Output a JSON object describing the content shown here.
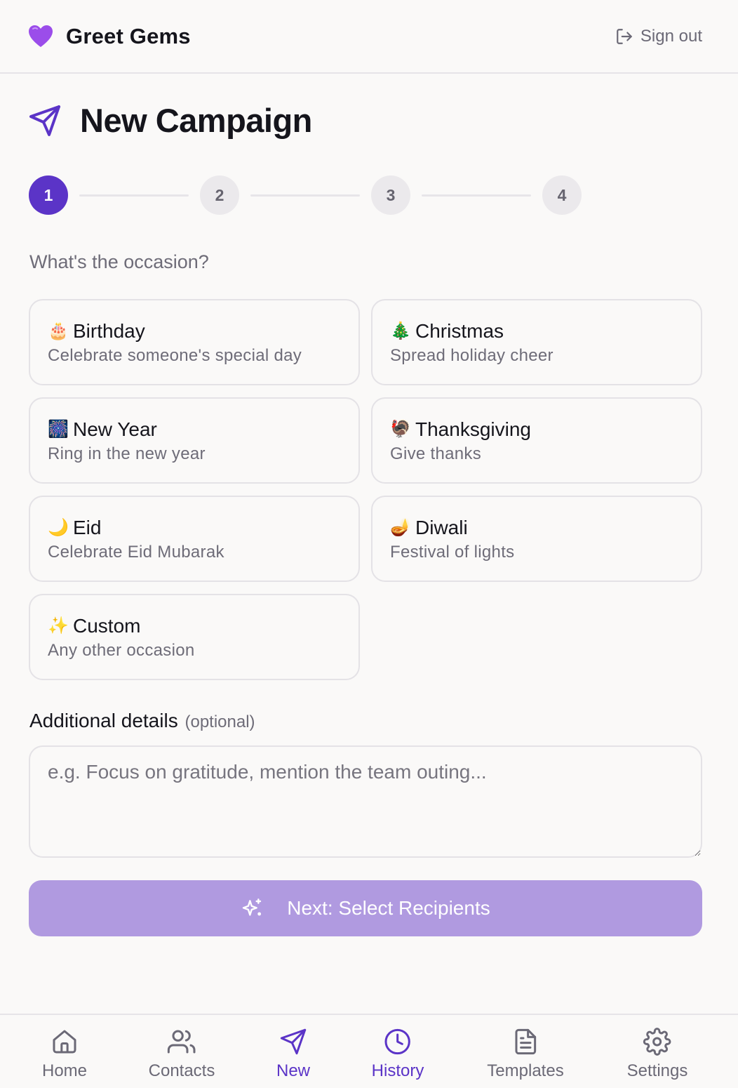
{
  "brand": {
    "emoji": "💜",
    "name": "Greet Gems",
    "signout": "Sign out"
  },
  "page": {
    "title": "New Campaign"
  },
  "steps": [
    "1",
    "2",
    "3",
    "4"
  ],
  "active_step": 1,
  "question": "What's the occasion?",
  "occasions": [
    {
      "emoji": "🎂",
      "title": "Birthday",
      "desc": "Celebrate someone's special day"
    },
    {
      "emoji": "🎄",
      "title": "Christmas",
      "desc": "Spread holiday cheer"
    },
    {
      "emoji": "🎆",
      "title": "New Year",
      "desc": "Ring in the new year"
    },
    {
      "emoji": "🦃",
      "title": "Thanksgiving",
      "desc": "Give thanks"
    },
    {
      "emoji": "🌙",
      "title": "Eid",
      "desc": "Celebrate Eid Mubarak"
    },
    {
      "emoji": "🪔",
      "title": "Diwali",
      "desc": "Festival of lights"
    },
    {
      "emoji": "✨",
      "title": "Custom",
      "desc": "Any other occasion"
    }
  ],
  "details": {
    "label": "Additional details",
    "optional": "(optional)",
    "placeholder": "e.g. Focus on gratitude, mention the team outing...",
    "value": ""
  },
  "next_button": "Next: Select Recipients",
  "colors": {
    "accent": "#5b34c7",
    "button": "#b09ae0",
    "muted": "#6b6976"
  },
  "nav": [
    {
      "label": "Home",
      "icon": "home-icon",
      "active": false
    },
    {
      "label": "Contacts",
      "icon": "users-icon",
      "active": false
    },
    {
      "label": "New",
      "icon": "send-icon",
      "active": true
    },
    {
      "label": "History",
      "icon": "clock-icon",
      "active": true
    },
    {
      "label": "Templates",
      "icon": "file-text-icon",
      "active": false
    },
    {
      "label": "Settings",
      "icon": "gear-icon",
      "active": false
    }
  ]
}
